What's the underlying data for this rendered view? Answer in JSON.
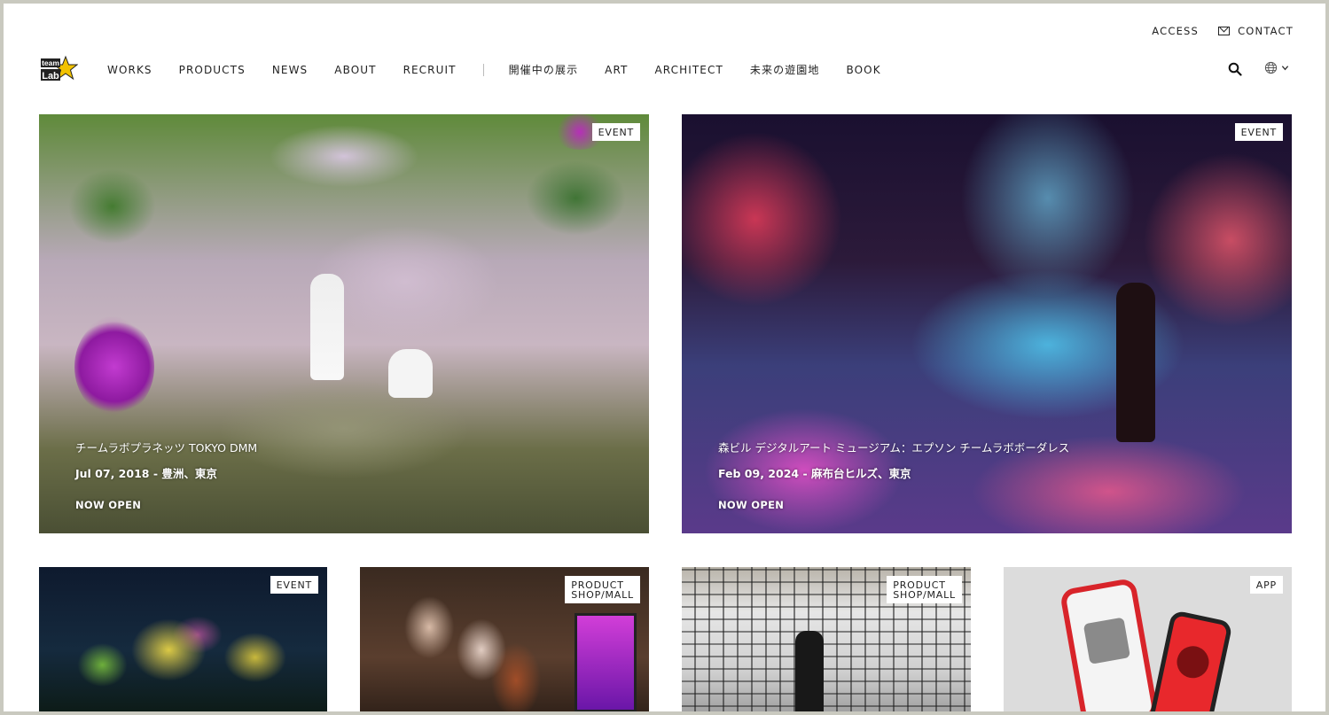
{
  "header": {
    "util_links": [
      {
        "label": "ACCESS"
      },
      {
        "label": "CONTACT"
      }
    ],
    "logo_text": "team Lab",
    "nav_left": [
      "WORKS",
      "PRODUCTS",
      "NEWS",
      "ABOUT",
      "RECRUIT"
    ],
    "nav_right": [
      "開催中の展示",
      "ART",
      "ARCHITECT",
      "未来の遊園地",
      "BOOK"
    ],
    "icons": [
      "search-icon",
      "globe-icon",
      "chevron-down-icon"
    ]
  },
  "featured": [
    {
      "badge": "EVENT",
      "title": "チームラボプラネッツ TOKYO DMM",
      "date": "Jul 07, 2018 - 豊洲、東京",
      "status": "NOW OPEN"
    },
    {
      "badge": "EVENT",
      "title": "森ビル デジタルアート ミュージアム：エプソン チームラボボーダレス",
      "date": "Feb 09, 2024 - 麻布台ヒルズ、東京",
      "status": "NOW OPEN"
    }
  ],
  "grid": [
    {
      "badge": "EVENT"
    },
    {
      "badge_line1": "PRODUCT",
      "badge_line2": "SHOP/MALL"
    },
    {
      "badge_line1": "PRODUCT",
      "badge_line2": "SHOP/MALL"
    },
    {
      "badge": "APP"
    }
  ],
  "colors": {
    "frame": "#c9c9bf",
    "background": "#ffffff",
    "text": "#222222",
    "logo_star": "#f2c200"
  }
}
